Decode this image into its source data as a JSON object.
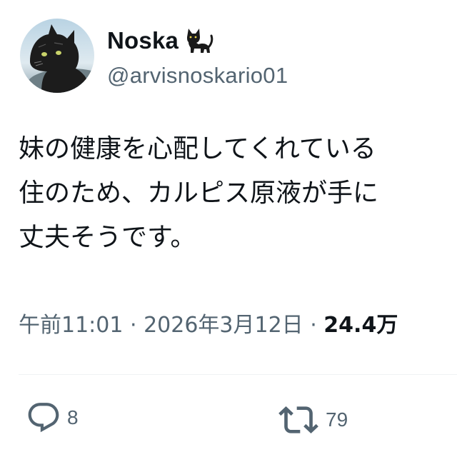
{
  "author": {
    "display_name": "Noska",
    "name_emoji": "black-cat-emoji",
    "handle": "@arvisnoskario01",
    "avatar": "black-cat-avatar"
  },
  "tweet": {
    "lines": [
      "妹の健康を心配してくれている",
      "住のため、カルピス原液が手に",
      "丈夫そうです。"
    ]
  },
  "meta": {
    "time": "午前11:01",
    "separator": " · ",
    "date": "2026年3月12日",
    "views": "24.4万"
  },
  "actions": {
    "reply": {
      "icon": "reply-icon",
      "count": "8"
    },
    "retweet": {
      "icon": "retweet-icon",
      "count": "79"
    }
  },
  "colors": {
    "text": "#0f1419",
    "secondary": "#536471",
    "divider": "#eff3f4"
  }
}
